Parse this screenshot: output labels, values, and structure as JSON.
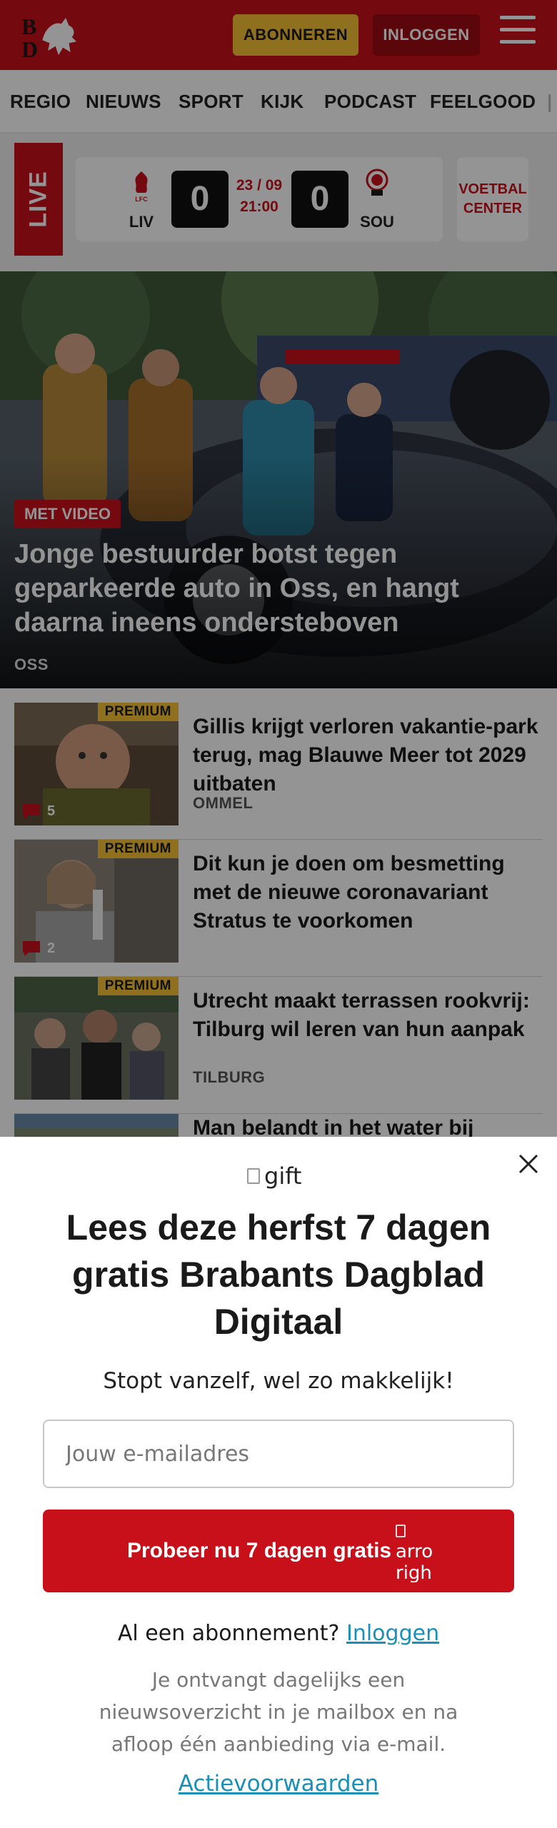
{
  "header": {
    "logo_alt": "BD",
    "subscribe_label": "ABONNEREN",
    "login_label": "INLOGGEN",
    "menu_icon": "hamburger-icon",
    "brand_color": "#c8101b"
  },
  "nav": {
    "items": [
      "REGIO",
      "NIEUWS",
      "SPORT",
      "KIJK",
      "PODCAST",
      "FEELGOOD"
    ]
  },
  "live": {
    "tag": "LIVE",
    "match": {
      "home_team": "LIV",
      "away_team": "SOU",
      "home_score": "0",
      "away_score": "0",
      "date": "23 / 09",
      "time": "21:00"
    },
    "center_label_line1": "VOETBAL",
    "center_label_line2": "CENTER"
  },
  "hero": {
    "badge": "MET VIDEO",
    "title": "Jonge bestuurder botst tegen geparkeerde auto in Oss, en hangt daarna ineens ondersteboven",
    "location": "OSS"
  },
  "articles": [
    {
      "premium": "PREMIUM",
      "comments": "5",
      "title": "Gillis krijgt verloren vakantie-park terug, mag Blauwe Meer tot 2029 uitbaten",
      "location": "OMMEL"
    },
    {
      "premium": "PREMIUM",
      "comments": "2",
      "title": "Dit kun je doen om besmetting met de nieuwe coronavariant Stratus te voorkomen",
      "location": ""
    },
    {
      "premium": "PREMIUM",
      "comments": "",
      "title": "Utrecht maakt terrassen rookvrij: Tilburg wil leren van hun aanpak",
      "location": "TILBURG"
    },
    {
      "premium": "",
      "comments": "",
      "title": "Man belandt in het water bij",
      "location": ""
    }
  ],
  "modal": {
    "gift_alt": "gift",
    "title": "Lees deze herfst 7 dagen gratis Brabants Dagblad Digitaal",
    "subtitle": "Stopt vanzelf, wel zo makkelijk!",
    "email_placeholder": "Jouw e-mailadres",
    "cta_label": "Probeer nu 7 dagen gratis",
    "cta_arrow_alt_1": "arro",
    "cta_arrow_alt_2": "righ",
    "account_question": "Al een abonnement?",
    "account_link": "Inloggen",
    "info": "Je ontvangt dagelijks een nieuwsoverzicht in je mailbox en na afloop één aanbieding via e-mail.",
    "terms_link": "Actievoorwaarden",
    "close_icon": "close-icon"
  }
}
